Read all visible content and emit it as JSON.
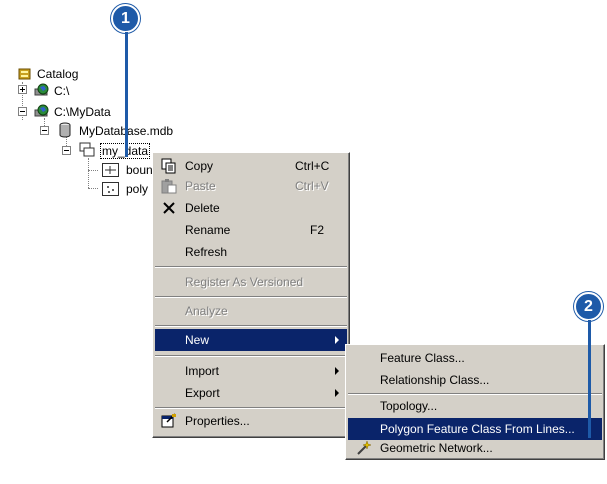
{
  "tree": {
    "root": "Catalog",
    "nodes": [
      {
        "label": "C:\\"
      },
      {
        "label": "C:\\MyData"
      },
      {
        "label": "MyDatabase.mdb"
      },
      {
        "label": "my_data"
      },
      {
        "label": "boun"
      },
      {
        "label": "poly"
      }
    ]
  },
  "context_menu": {
    "items": [
      {
        "label": "Copy",
        "shortcut": "Ctrl+C",
        "enabled": true,
        "icon": "copy-icon"
      },
      {
        "label": "Paste",
        "shortcut": "Ctrl+V",
        "enabled": false,
        "icon": "paste-icon"
      },
      {
        "label": "Delete",
        "shortcut": "",
        "enabled": true,
        "icon": "delete-x-icon"
      },
      {
        "label": "Rename",
        "shortcut": "F2",
        "enabled": true
      },
      {
        "label": "Refresh",
        "shortcut": "",
        "enabled": true
      },
      {
        "label": "Register As Versioned",
        "shortcut": "",
        "enabled": false
      },
      {
        "label": "Analyze",
        "shortcut": "",
        "enabled": false
      },
      {
        "label": "New",
        "shortcut": "",
        "enabled": true,
        "submenu": true,
        "highlighted": true
      },
      {
        "label": "Import",
        "shortcut": "",
        "enabled": true,
        "submenu": true
      },
      {
        "label": "Export",
        "shortcut": "",
        "enabled": true,
        "submenu": true
      },
      {
        "label": "Properties...",
        "shortcut": "",
        "enabled": true,
        "icon": "properties-icon"
      }
    ]
  },
  "submenu_new": {
    "items": [
      {
        "label": "Feature Class..."
      },
      {
        "label": "Relationship Class..."
      },
      {
        "label": "Topology..."
      },
      {
        "label": "Polygon Feature Class From Lines...",
        "highlighted": true
      },
      {
        "label": "Geometric Network...",
        "icon": "geometric-network-wand-icon"
      }
    ]
  },
  "callouts": [
    "1",
    "2"
  ],
  "colors": {
    "menu_bg": "#d4d0c8",
    "highlight": "#0a246a",
    "callout": "#1e5aa8"
  }
}
